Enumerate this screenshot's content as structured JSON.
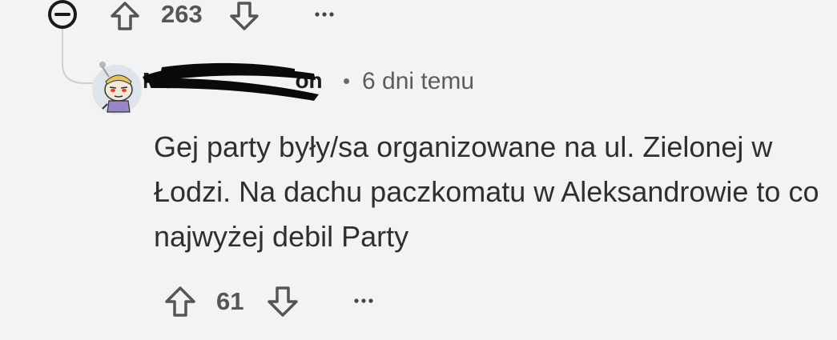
{
  "parent": {
    "score": "263",
    "collapse_icon": "minus-circle-icon",
    "upvote_icon": "arrow-up-outline-icon",
    "downvote_icon": "arrow-down-outline-icon",
    "more_icon": "ellipsis-icon"
  },
  "comment": {
    "username_visible_fragment_start": "Mo",
    "username_visible_fragment_end": "on",
    "meta_separator": "•",
    "timestamp": "6 dni temu",
    "body": "Gej party były/sa organizowane na ul. Zielonej w Łodzi. Na dachu paczkomatu w Aleksandrowie to co najwyżej debil Party",
    "score": "61",
    "avatar_icon": "snoo-avatar-icon",
    "upvote_icon": "arrow-up-outline-icon",
    "downvote_icon": "arrow-down-outline-icon",
    "more_icon": "ellipsis-icon"
  },
  "colors": {
    "background": "#f3f3f3",
    "text": "#2b2b2b",
    "muted": "#5c5c5c",
    "redaction": "#0a0a0a"
  }
}
